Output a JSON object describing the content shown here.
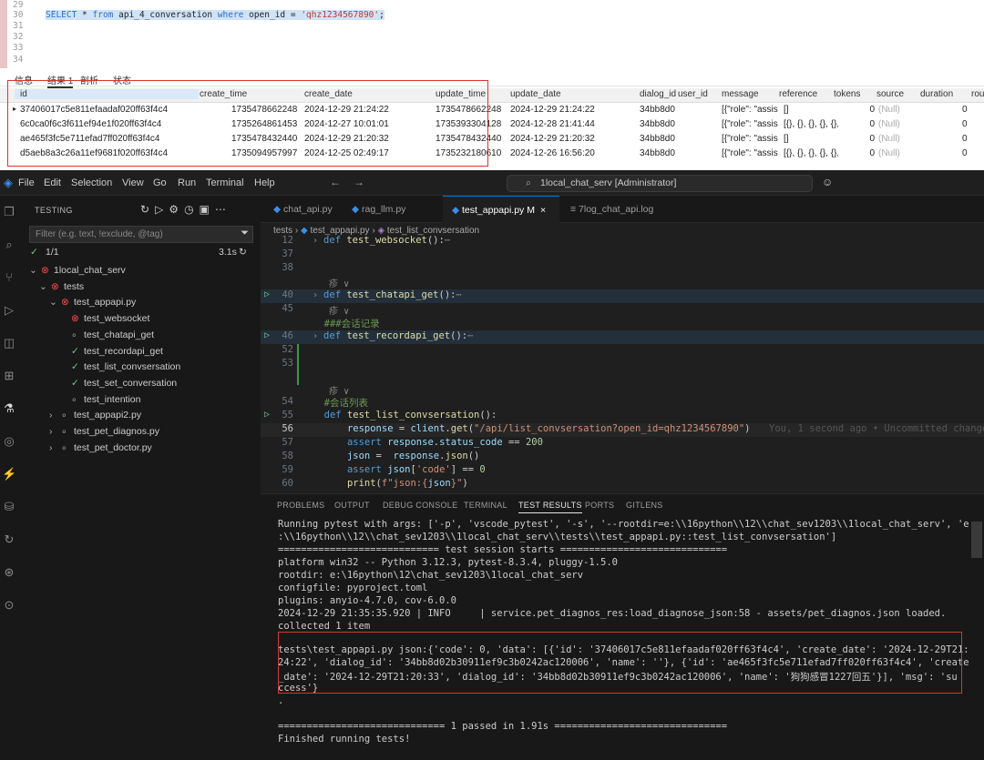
{
  "sql": {
    "line_numbers": [
      "29",
      "30",
      "31",
      "32",
      "33",
      "34"
    ],
    "query_kw1": "SELECT",
    "query_a": " * ",
    "query_kw2": "from",
    "query_b": " api_4_conversation ",
    "query_kw3": "where",
    "query_c": " open_id = ",
    "query_str": "'qhz1234567890'",
    "query_end": ";"
  },
  "result_tabs": [
    "信息",
    "结果 1",
    "剖析",
    "状态"
  ],
  "grid": {
    "columns": [
      "id",
      "create_time",
      "create_date",
      "update_time",
      "update_date",
      "dialog_id",
      "user_id",
      "message",
      "reference",
      "tokens",
      "source",
      "duration",
      "rou"
    ],
    "rows": [
      [
        "37406017c5e811efaadaf020ff63f4c4",
        "1735478662248",
        "2024-12-29 21:24:22",
        "1735478662248",
        "2024-12-29 21:24:22",
        "34bb8d0",
        "[{\"role\": \"assis",
        "[]",
        "0",
        "(Null)",
        "0"
      ],
      [
        "6c0ca0f6c3f611ef94e1f020ff63f4c4",
        "1735264861453",
        "2024-12-27 10:01:01",
        "1735393304128",
        "2024-12-28 21:41:44",
        "34bb8d0",
        "[{\"role\": \"assis",
        "[{}, {}, {}, {}, {},",
        "0",
        "(Null)",
        "0"
      ],
      [
        "ae465f3fc5e711efad7ff020ff63f4c4",
        "1735478432440",
        "2024-12-29 21:20:32",
        "1735478432440",
        "2024-12-29 21:20:32",
        "34bb8d0",
        "[{\"role\": \"assis",
        "[]",
        "0",
        "(Null)",
        "0"
      ],
      [
        "d5aeb8a3c26a11ef9681f020ff63f4c4",
        "1735094957997",
        "2024-12-25 02:49:17",
        "1735232180610",
        "2024-12-26 16:56:20",
        "34bb8d0",
        "[{\"role\": \"assis",
        "[{}, {}, {}, {}, {},",
        "0",
        "(Null)",
        "0"
      ]
    ]
  },
  "vscode": {
    "menu": [
      "File",
      "Edit",
      "Selection",
      "View",
      "Go",
      "Run",
      "Terminal",
      "Help"
    ],
    "command_center": "1local_chat_serv [Administrator]",
    "sidebar_title": "TESTING",
    "filter_placeholder": "Filter (e.g. text, !exclude, @tag)",
    "summary_count": "1/1",
    "summary_time": "3.1s",
    "tree": [
      {
        "label": "1local_chat_serv",
        "status": "fail",
        "depth": 0,
        "arrow": "v"
      },
      {
        "label": "tests",
        "status": "fail",
        "depth": 1,
        "arrow": "v"
      },
      {
        "label": "test_appapi.py",
        "status": "fail",
        "depth": 2,
        "arrow": "v"
      },
      {
        "label": "test_websocket",
        "status": "fail",
        "depth": 3,
        "arrow": ""
      },
      {
        "label": "test_chatapi_get",
        "status": "none",
        "depth": 3,
        "arrow": ""
      },
      {
        "label": "test_recordapi_get",
        "status": "ok",
        "depth": 3,
        "arrow": ""
      },
      {
        "label": "test_list_convsersation",
        "status": "ok",
        "depth": 3,
        "arrow": ""
      },
      {
        "label": "test_set_conversation",
        "status": "ok",
        "depth": 3,
        "arrow": ""
      },
      {
        "label": "test_intention",
        "status": "none",
        "depth": 3,
        "arrow": ""
      },
      {
        "label": "test_appapi2.py",
        "status": "none",
        "depth": 2,
        "arrow": ">"
      },
      {
        "label": "test_pet_diagnos.py",
        "status": "none",
        "depth": 2,
        "arrow": ">"
      },
      {
        "label": "test_pet_doctor.py",
        "status": "none",
        "depth": 2,
        "arrow": ">"
      }
    ],
    "tabs": [
      "chat_api.py",
      "rag_llm.py",
      "test_appapi.py M",
      "7log_chat_api.log"
    ],
    "breadcrumb": [
      "tests",
      "test_appapi.py",
      "test_list_convsersation"
    ],
    "panel_tabs": [
      "PROBLEMS",
      "OUTPUT",
      "DEBUG CONSOLE",
      "TERMINAL",
      "TEST RESULTS",
      "PORTS",
      "GITLENS"
    ],
    "blame": "You, 1 second ago • Uncommitted changes",
    "terminal": [
      "Running pytest with args: ['-p', 'vscode_pytest', '-s', '--rootdir=e:\\\\16python\\\\12\\\\chat_sev1203\\\\1local_chat_serv', 'e",
      ":\\\\16python\\\\12\\\\chat_sev1203\\\\1local_chat_serv\\\\tests\\\\test_appapi.py::test_list_convsersation']",
      "============================ test session starts =============================",
      "platform win32 -- Python 3.12.3, pytest-8.3.4, pluggy-1.5.0",
      "rootdir: e:\\16python\\12\\chat_sev1203\\1local_chat_serv",
      "configfile: pyproject.toml",
      "plugins: anyio-4.7.0, cov-6.0.0",
      "2024-12-29 21:35:35.920 | INFO     | service.pet_diagnos_res:load_diagnose_json:58 - assets/pet_diagnos.json loaded.",
      "collected 1 item",
      "",
      "tests\\test_appapi.py json:{'code': 0, 'data': [{'id': '37406017c5e811efaadaf020ff63f4c4', 'create_date': '2024-12-29T21:",
      "24:22', 'dialog_id': '34bb8d02b30911ef9c3b0242ac120006', 'name': ''}, {'id': 'ae465f3fc5e711efad7ff020ff63f4c4', 'create",
      "_date': '2024-12-29T21:20:33', 'dialog_id': '34bb8d02b30911ef9c3b0242ac120006', 'name': '狗狗感冒1227回五'}], 'msg': 'su",
      "ccess'}",
      ".",
      "",
      "============================= 1 passed in 1.91s ==============================",
      "Finished running tests!"
    ]
  }
}
